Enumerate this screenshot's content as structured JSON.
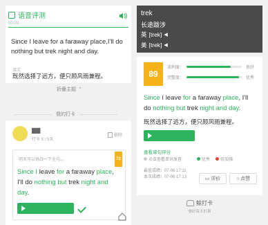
{
  "left": {
    "header": {
      "title": "语音评测",
      "subtitle": "00:03"
    },
    "sentence": "Since I leave for a faraway place,I'll do nothing but trek night and day.",
    "translation_tag": "译文",
    "translation": "既然选择了远方，便只顾风雨兼程。",
    "collapse_label": "折叠主题",
    "section_title": "我的打卡",
    "user": {
      "name": "▇▇",
      "meta": "打卡 5 / 5天",
      "action_label": "删除"
    },
    "eval_card": {
      "hint": "明天可以挑战一下全句。。",
      "score": "72",
      "sentence_parts": [
        {
          "text": "Since ",
          "hl": true
        },
        {
          "text": "I ",
          "hl": true
        },
        {
          "text": "leave ",
          "hl": false
        },
        {
          "text": "for ",
          "hl": true
        },
        {
          "text": "a faraway ",
          "hl": false
        },
        {
          "text": "place",
          "hl": true
        },
        {
          "text": ", I'll do ",
          "hl": false
        },
        {
          "text": "nothing but ",
          "hl": true
        },
        {
          "text": "trek ",
          "hl": false
        },
        {
          "text": "night and day",
          "hl": true
        },
        {
          "text": ".",
          "hl": false
        }
      ]
    }
  },
  "right": {
    "popup": {
      "word": "trek",
      "meaning": "长途跋涉",
      "uk_label": "英",
      "uk_ipa": "[trek]",
      "us_label": "美",
      "us_ipa": "[trek]"
    },
    "score": "89",
    "metrics": [
      {
        "label": "流利度：",
        "value": 0.8,
        "grade": "良好"
      },
      {
        "label": "完整度：",
        "value": 0.95,
        "grade": "优秀"
      }
    ],
    "sentence_parts": [
      {
        "text": "Since ",
        "hl": true
      },
      {
        "text": "I ",
        "hl": false
      },
      {
        "text": "leave ",
        "hl": false
      },
      {
        "text": "for ",
        "hl": true
      },
      {
        "text": "a faraway ",
        "hl": false
      },
      {
        "text": "place",
        "hl": true
      },
      {
        "text": ", I'll do ",
        "hl": false
      },
      {
        "text": "nothing but ",
        "hl": true
      },
      {
        "text": "trek ",
        "hl": false
      },
      {
        "text": "night and day",
        "hl": true
      },
      {
        "text": ".",
        "hl": false
      }
    ],
    "translation": "既然选择了远方，便只顾风雨兼程。",
    "report_link": "查看单句评分",
    "legend": [
      {
        "label": "点击查看单词发音",
        "color": "#cccccc"
      },
      {
        "label": "优秀",
        "color": "#2db35d"
      },
      {
        "label": "待加强",
        "color": "#e0443a"
      }
    ],
    "dates": [
      {
        "label": "最佳成绩：",
        "value": "07-06 17:11"
      },
      {
        "label": "本次成绩：",
        "value": "07-06 17:13"
      }
    ],
    "buttons": {
      "review": "评价",
      "like": "点赞"
    },
    "brand": {
      "name": "鲸打卡",
      "slogan": "做好每天的事"
    }
  }
}
